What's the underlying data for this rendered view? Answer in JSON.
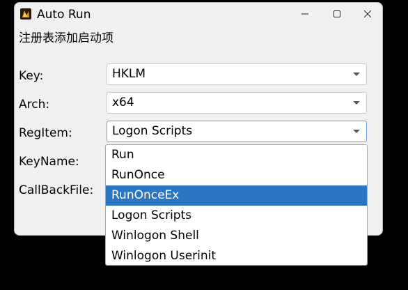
{
  "window": {
    "title": "Auto Run",
    "subtitle": "注册表添加启动项"
  },
  "form": {
    "key_label": "Key:",
    "key_value": "HKLM",
    "arch_label": "Arch:",
    "arch_value": "x64",
    "regitem_label": "RegItem:",
    "regitem_value": "Logon Scripts",
    "keyname_label": "KeyName:",
    "callbackfile_label": "CallBackFile:"
  },
  "dropdown": {
    "items": [
      {
        "label": "Run"
      },
      {
        "label": "RunOnce"
      },
      {
        "label": "RunOnceEx"
      },
      {
        "label": "Logon Scripts"
      },
      {
        "label": "Winlogon Shell"
      },
      {
        "label": "Winlogon Userinit"
      }
    ],
    "highlighted_item": "RunOnceEx"
  },
  "colors": {
    "highlight": "#2b75c2",
    "window_bg": "#f0f0f0",
    "focus_border": "#6f9fd8"
  },
  "icons": [
    "app-icon",
    "minimize-icon",
    "maximize-icon",
    "close-icon",
    "dropdown-arrow-icon"
  ]
}
